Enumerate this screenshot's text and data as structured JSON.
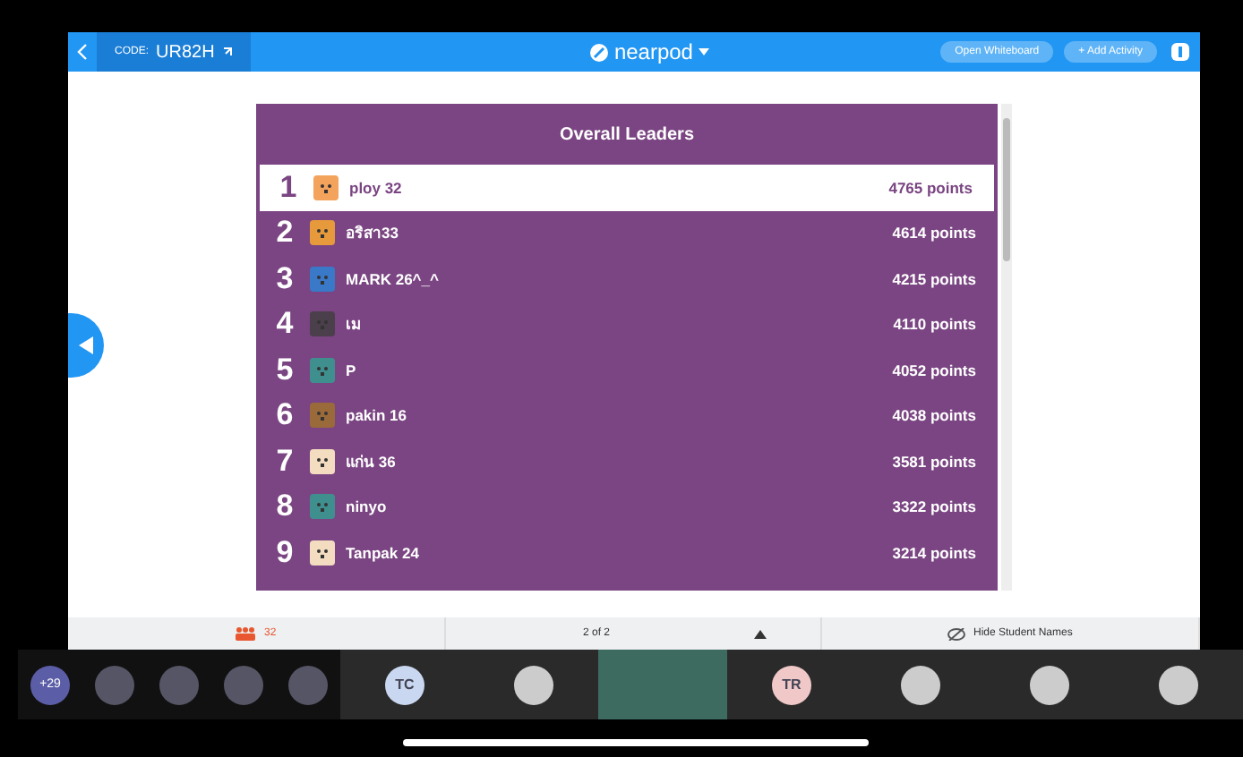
{
  "top_bar": {
    "code_label": "CODE:",
    "code": "UR82H",
    "logo_text": "nearpod",
    "buttons": [
      "Open Whiteboard",
      "+ Add Activity"
    ]
  },
  "leaderboard": {
    "title": "Overall Leaders",
    "rows": [
      {
        "rank": "1",
        "name": "ploy 32",
        "points": "4765 points",
        "selected": true,
        "color": "#f4a35c"
      },
      {
        "rank": "2",
        "name": "อริสา33",
        "points": "4614 points",
        "selected": false,
        "color": "#e69a3c"
      },
      {
        "rank": "3",
        "name": "MARK 26^_^",
        "points": "4215 points",
        "selected": false,
        "color": "#3a78c8"
      },
      {
        "rank": "4",
        "name": "เม",
        "points": "4110 points",
        "selected": false,
        "color": "#4a3f4a"
      },
      {
        "rank": "5",
        "name": "P",
        "points": "4052 points",
        "selected": false,
        "color": "#3f8f8f"
      },
      {
        "rank": "6",
        "name": "pakin 16",
        "points": "4038 points",
        "selected": false,
        "color": "#9a6a3a"
      },
      {
        "rank": "7",
        "name": "แก่น 36",
        "points": "3581 points",
        "selected": false,
        "color": "#f3dcc0"
      },
      {
        "rank": "8",
        "name": "ninyo",
        "points": "3322 points",
        "selected": false,
        "color": "#3f8f8f"
      },
      {
        "rank": "9",
        "name": "Tanpak 24",
        "points": "3214 points",
        "selected": false,
        "color": "#f3dcc0"
      }
    ]
  },
  "footer": {
    "student_count": "32",
    "page": "2 of 2",
    "hide_names": "Hide Student Names"
  },
  "participants": [
    {
      "kind": "count",
      "text": "+29"
    },
    {
      "kind": "photo"
    },
    {
      "kind": "photo"
    },
    {
      "kind": "photo"
    },
    {
      "kind": "photo"
    },
    {
      "kind": "initials",
      "text": "TC",
      "color": "#c9d8f0"
    },
    {
      "kind": "avatar"
    },
    {
      "kind": "video"
    },
    {
      "kind": "initials",
      "text": "TR",
      "color": "#f0c8c8"
    },
    {
      "kind": "avatar"
    },
    {
      "kind": "avatar"
    },
    {
      "kind": "avatar"
    }
  ]
}
